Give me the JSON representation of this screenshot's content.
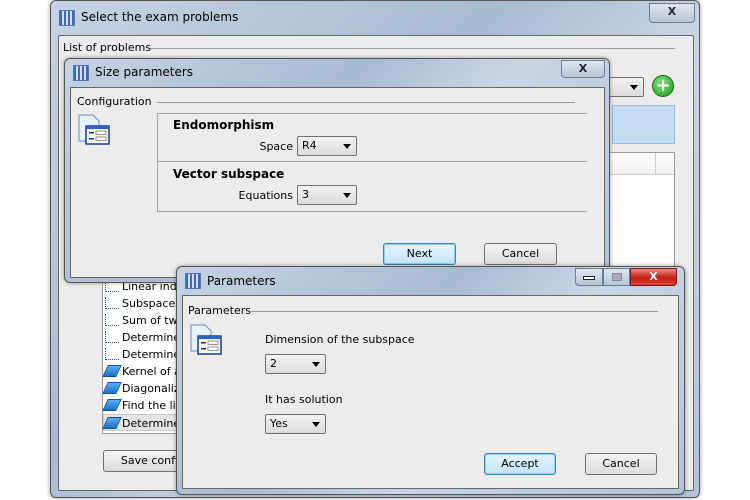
{
  "main_window": {
    "title": "Select the exam problems",
    "close": "X",
    "section": "List of problems",
    "problems": [
      {
        "label": "Linear inde",
        "icon": "vector-icon"
      },
      {
        "label": "Subspace s",
        "icon": "vector-icon"
      },
      {
        "label": "Sum of two",
        "icon": "vector-icon"
      },
      {
        "label": "Determine",
        "icon": "vector-icon"
      },
      {
        "label": "Determine",
        "icon": "vector-icon"
      },
      {
        "label": "Kernel of a",
        "icon": "parallelogram-icon"
      },
      {
        "label": "Diagonaliza",
        "icon": "parallelogram-icon"
      },
      {
        "label": "Find the lin",
        "icon": "parallelogram-icon"
      },
      {
        "label": "Determine",
        "icon": "parallelogram-icon"
      }
    ],
    "save_button": "Save config"
  },
  "size_dialog": {
    "title": "Size parameters",
    "close": "X",
    "section": "Configuration",
    "group1": {
      "title": "Endomorphism",
      "label": "Space",
      "value": "R4"
    },
    "group2": {
      "title": "Vector subspace",
      "label": "Equations",
      "value": "3"
    },
    "next": "Next",
    "cancel": "Cancel"
  },
  "param_dialog": {
    "title": "Parameters",
    "close": "X",
    "section": "Parameters",
    "dim_label": "Dimension of the subspace",
    "dim_value": "2",
    "sol_label": "It has solution",
    "sol_value": "Yes",
    "accept": "Accept",
    "cancel": "Cancel"
  }
}
